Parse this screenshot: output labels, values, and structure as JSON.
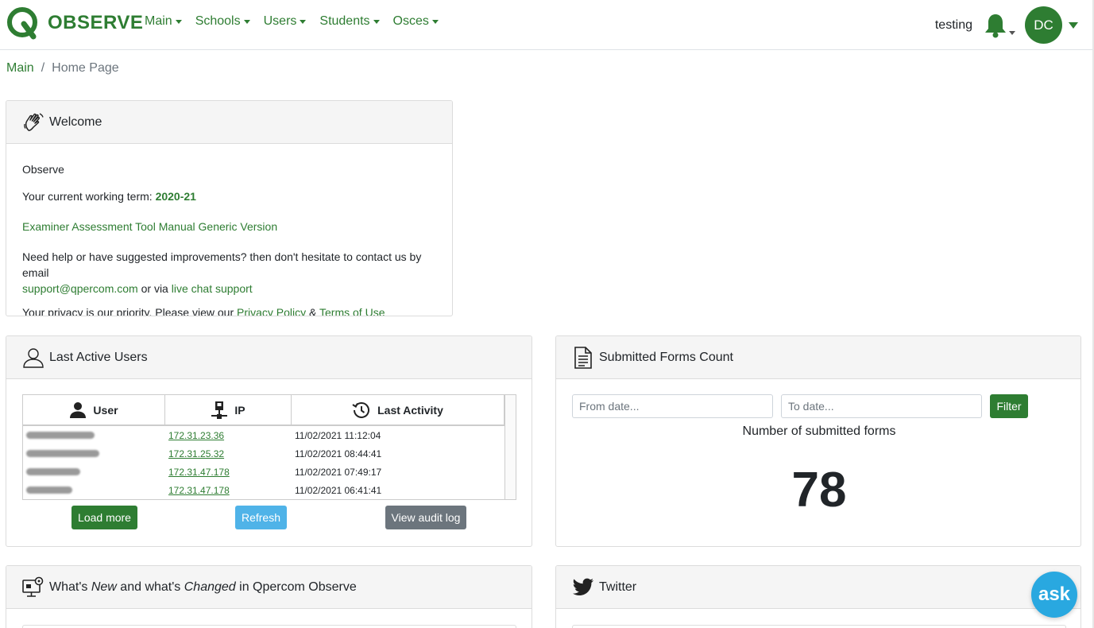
{
  "brand": {
    "name": "OBSERVE",
    "color": "#2e7d32"
  },
  "nav": {
    "items": [
      {
        "label": "Main"
      },
      {
        "label": "Schools"
      },
      {
        "label": "Users"
      },
      {
        "label": "Students"
      },
      {
        "label": "Osces"
      }
    ],
    "term": "testing",
    "avatar_initials": "DC"
  },
  "breadcrumb": {
    "parent": "Main",
    "separator": "/",
    "current": "Home Page"
  },
  "welcome": {
    "title": "Welcome",
    "app_name": "Observe",
    "term_prefix": "Your current working term: ",
    "term_value": "2020-21",
    "manual_link": "Examiner Assessment Tool Manual Generic Version",
    "help_text": "Need help or have suggested improvements? then don't hesitate to contact us by email",
    "support_email": "support@qpercom.com",
    "or_via": " or via ",
    "chat_link": "live chat support",
    "privacy_prefix": "Your privacy is our priority. Please view our ",
    "privacy_link": "Privacy Policy",
    "amp": " & ",
    "terms_link": "Terms of Use"
  },
  "active_users": {
    "title": "Last Active Users",
    "columns": {
      "user": "User",
      "ip": "IP",
      "last": "Last Activity"
    },
    "rows": [
      {
        "ip": "172.31.23.36",
        "last": "11/02/2021 11:12:04"
      },
      {
        "ip": "172.31.25.32",
        "last": "11/02/2021 08:44:41"
      },
      {
        "ip": "172.31.47.178",
        "last": "11/02/2021 07:49:17"
      },
      {
        "ip": "172.31.47.178",
        "last": "11/02/2021 06:41:41"
      }
    ],
    "buttons": {
      "load_more": "Load more",
      "refresh": "Refresh",
      "audit": "View audit log"
    }
  },
  "forms": {
    "title": "Submitted Forms Count",
    "from_placeholder": "From date...",
    "to_placeholder": "To date...",
    "filter_label": "Filter",
    "caption": "Number of submitted forms",
    "count": "78"
  },
  "news": {
    "title_a": "What's ",
    "title_new": "New",
    "title_b": " and what's ",
    "title_changed": "Changed",
    "title_c": " in Qpercom Observe"
  },
  "twitter": {
    "title": "Twitter"
  },
  "ask": {
    "label": "ask"
  }
}
